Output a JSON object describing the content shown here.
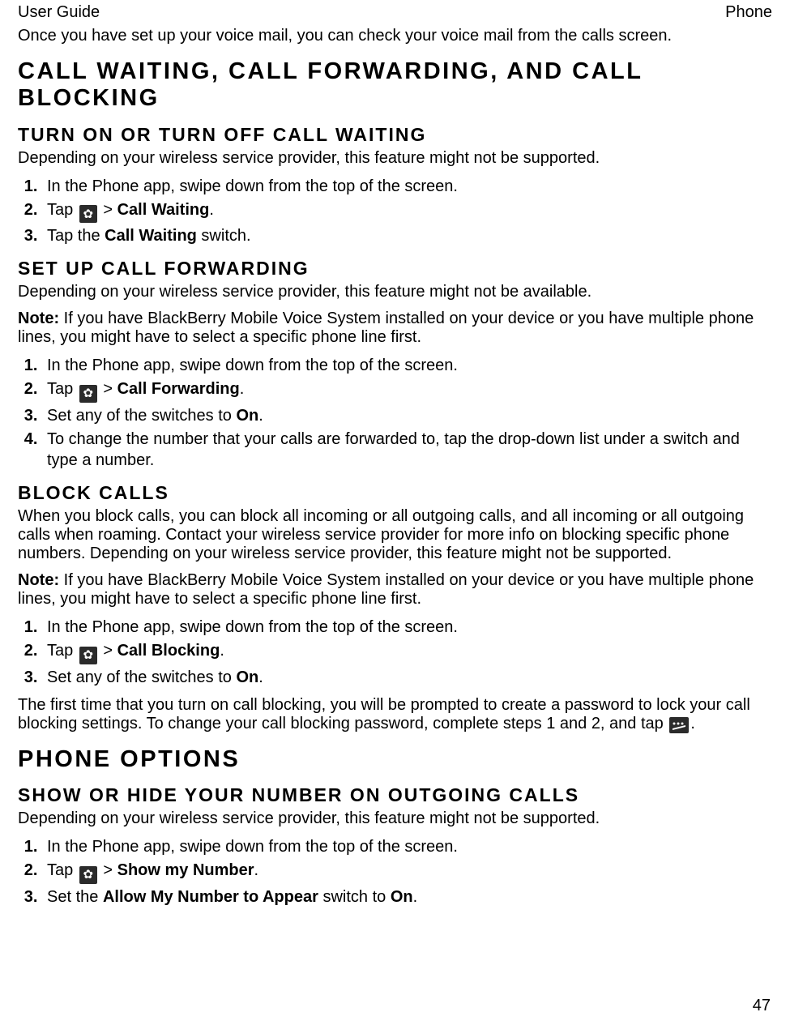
{
  "header": {
    "left": "User Guide",
    "right": "Phone"
  },
  "intro": "Once you have set up your voice mail, you can check your voice mail from the calls screen.",
  "h1_a": "Call waiting, call forwarding, and call blocking",
  "sec_cw": {
    "title": "Turn on or turn off call waiting",
    "p": "Depending on your wireless service provider, this feature might not be supported.",
    "steps": {
      "s1": "In the Phone app, swipe down from the top of the screen.",
      "s2a": "Tap ",
      "s2b": " > ",
      "s2c": "Call Waiting",
      "s2d": ".",
      "s3a": "Tap the ",
      "s3b": "Call Waiting",
      "s3c": " switch."
    }
  },
  "sec_cf": {
    "title": "Set up call forwarding",
    "p": "Depending on your wireless service provider, this feature might not be available.",
    "note_label": "Note:",
    "note": " If you have BlackBerry Mobile Voice System installed on your device or you have multiple phone lines, you might have to select a specific phone line first.",
    "steps": {
      "s1": "In the Phone app, swipe down from the top of the screen.",
      "s2a": "Tap ",
      "s2b": " > ",
      "s2c": "Call Forwarding",
      "s2d": ".",
      "s3a": "Set any of the switches to ",
      "s3b": "On",
      "s3c": ".",
      "s4": "To change the number that your calls are forwarded to, tap the drop-down list under a switch and type a number."
    }
  },
  "sec_bl": {
    "title": "Block calls",
    "p": "When you block calls, you can block all incoming or all outgoing calls, and all incoming or all outgoing calls when roaming. Contact your wireless service provider for more info on blocking specific phone numbers. Depending on your wireless service provider, this feature might not be supported.",
    "note_label": "Note:",
    "note": " If you have BlackBerry Mobile Voice System installed on your device or you have multiple phone lines, you might have to select a specific phone line first.",
    "steps": {
      "s1": "In the Phone app, swipe down from the top of the screen.",
      "s2a": "Tap ",
      "s2b": " > ",
      "s2c": "Call Blocking",
      "s2d": ".",
      "s3a": "Set any of the switches to ",
      "s3b": "On",
      "s3c": "."
    },
    "after_a": "The first time that you turn on call blocking, you will be prompted to create a password to lock your call blocking settings. To change your call blocking password, complete steps 1 and 2, and tap ",
    "after_b": "."
  },
  "h1_b": "Phone options",
  "sec_po": {
    "title": "Show or hide your number on outgoing calls",
    "p": "Depending on your wireless service provider, this feature might not be supported.",
    "steps": {
      "s1": "In the Phone app, swipe down from the top of the screen.",
      "s2a": "Tap ",
      "s2b": " > ",
      "s2c": "Show my Number",
      "s2d": ".",
      "s3a": "Set the ",
      "s3b": "Allow My Number to Appear",
      "s3c": " switch to ",
      "s3d": "On",
      "s3e": "."
    }
  },
  "page_number": "47"
}
